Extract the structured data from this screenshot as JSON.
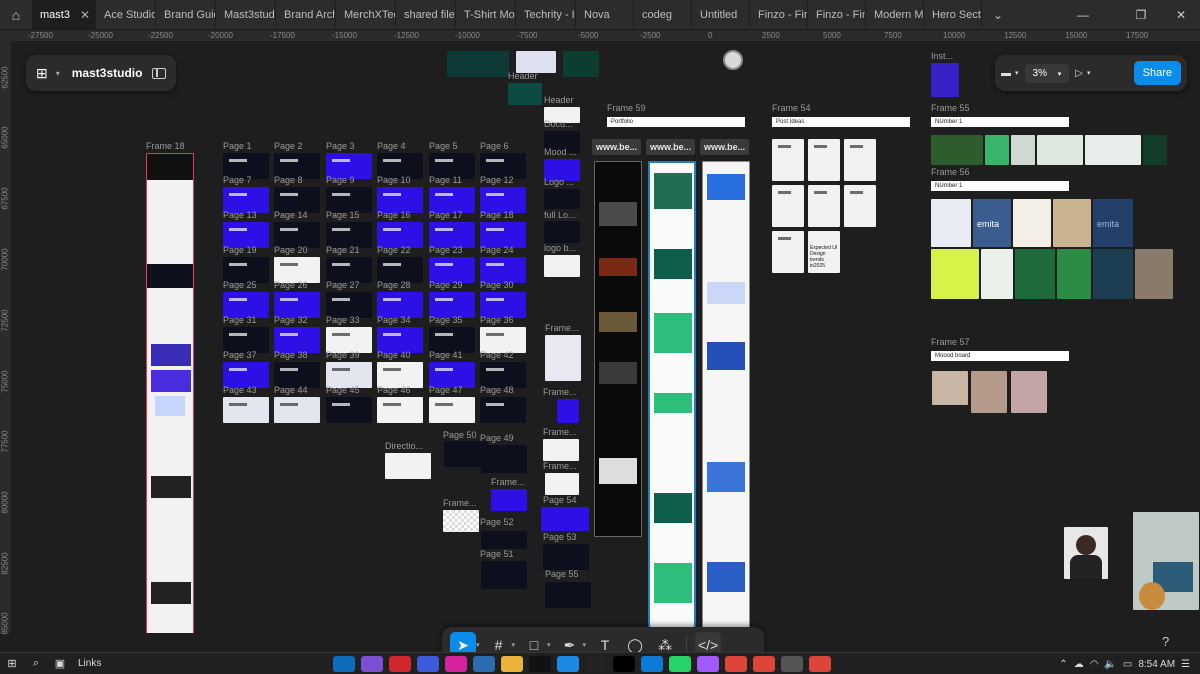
{
  "tabs": [
    {
      "label": "mast3",
      "active": true
    },
    {
      "label": "Ace Studio"
    },
    {
      "label": "Brand Guid"
    },
    {
      "label": "Mast3stud"
    },
    {
      "label": "Brand Arch"
    },
    {
      "label": "MerchXTec"
    },
    {
      "label": "shared file"
    },
    {
      "label": "T-Shirt Mo"
    },
    {
      "label": "Techrity - I"
    },
    {
      "label": "Nova"
    },
    {
      "label": "codeg"
    },
    {
      "label": "Untitled"
    },
    {
      "label": "Finzo - Fin"
    },
    {
      "label": "Finzo - Fin"
    },
    {
      "label": "Modern Mi"
    },
    {
      "label": "Hero Secti"
    }
  ],
  "ruler": {
    "top": [
      "-27500",
      "-25000",
      "-22500",
      "-20000",
      "-17500",
      "-15000",
      "-12500",
      "-10000",
      "-7500",
      "-5000",
      "-2500",
      "0",
      "2500",
      "5000",
      "7500",
      "10000",
      "12500",
      "15000",
      "17500"
    ],
    "left": [
      "62500",
      "65000",
      "67500",
      "70000",
      "72500",
      "75000",
      "77500",
      "80000",
      "82500",
      "85000"
    ]
  },
  "file": {
    "name": "mast3studio"
  },
  "view": {
    "zoom": "3%",
    "share_label": "Share"
  },
  "canvas": {
    "frame18": "Frame 18",
    "pages": [
      "Page 1",
      "Page 2",
      "Page 3",
      "Page 4",
      "Page 5",
      "Page 6",
      "Page 7",
      "Page 8",
      "Page 9",
      "Page 10",
      "Page 11",
      "Page 12",
      "Page 13",
      "Page 14",
      "Page 15",
      "Page 16",
      "Page 17",
      "Page 18",
      "Page 19",
      "Page 20",
      "Page 21",
      "Page 22",
      "Page 23",
      "Page 24",
      "Page 25",
      "Page 26",
      "Page 27",
      "Page 28",
      "Page 29",
      "Page 30",
      "Page 31",
      "Page 32",
      "Page 33",
      "Page 34",
      "Page 35",
      "Page 36",
      "Page 37",
      "Page 38",
      "Page 39",
      "Page 40",
      "Page 41",
      "Page 42",
      "Page 43",
      "Page 44",
      "Page 45",
      "Page 46",
      "Page 47",
      "Page 48"
    ],
    "extra_pages": [
      "Page 49",
      "Page 50",
      "Page 52",
      "Page 51",
      "Page 53",
      "Page 54",
      "Page 55"
    ],
    "side_labels": [
      "Header",
      "Header",
      "Docu...",
      "Mood ...",
      "Logo ...",
      "full Lo...",
      "logo b...",
      "Frame...",
      "Frame...",
      "Frame...",
      "Frame...",
      "Frame...",
      "Directio...",
      "Frame..."
    ],
    "frame59": "Frame 59",
    "portfolio": "Portfolio",
    "url_label": "www.be...",
    "frame54": "Frame 54",
    "post_ideas": "Post Ideas",
    "frame55": "Frame 55",
    "number1": "NUmber 1",
    "frame56": "Frame 56",
    "number1b": "NUmber 1",
    "frame57": "Frame 57",
    "mood_board": "Moood board",
    "inst": "Inst...",
    "post_card_title": "Expected UI Design trends in2025",
    "brand": "emita"
  },
  "taskbar": {
    "links": "Links",
    "time": "8:54 AM"
  }
}
